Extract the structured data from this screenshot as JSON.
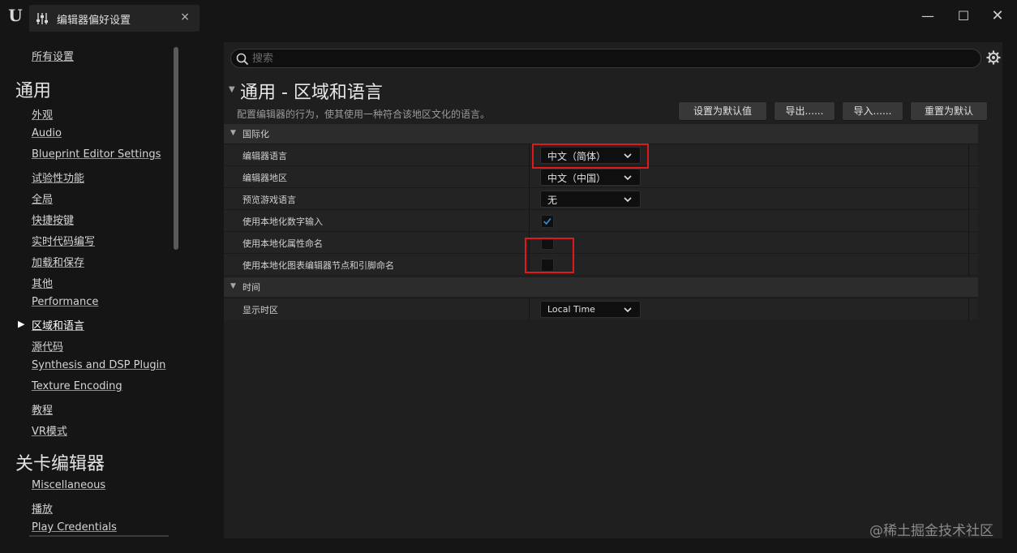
{
  "window": {
    "tab_title": "编辑器偏好设置",
    "tab_close_glyph": "×",
    "minimize_glyph": "—",
    "maximize_glyph": "☐",
    "close_glyph": "✕",
    "logo_text": "U"
  },
  "sidebar": {
    "all_settings": "所有设置",
    "sections": [
      {
        "heading": "通用",
        "items": [
          {
            "label": "外观"
          },
          {
            "label": "Audio"
          },
          {
            "label": "Blueprint Editor Settings"
          },
          {
            "label": "试验性功能"
          },
          {
            "label": "全局"
          },
          {
            "label": "快捷按键"
          },
          {
            "label": "实时代码编写"
          },
          {
            "label": "加载和保存"
          },
          {
            "label": "其他"
          },
          {
            "label": "Performance"
          },
          {
            "label": "区域和语言",
            "selected": true
          },
          {
            "label": "源代码"
          },
          {
            "label": "Synthesis and DSP Plugin"
          },
          {
            "label": "Texture Encoding"
          },
          {
            "label": "教程"
          },
          {
            "label": "VR模式"
          }
        ]
      },
      {
        "heading": "关卡编辑器",
        "items": [
          {
            "label": "Miscellaneous"
          },
          {
            "label": "播放"
          },
          {
            "label": "Play Credentials"
          }
        ]
      }
    ],
    "selected_arrow": "▶"
  },
  "search": {
    "placeholder": "搜索",
    "value": ""
  },
  "page": {
    "title": "通用 - 区域和语言",
    "description": "配置编辑器的行为，使其使用一种符合该地区文化的语言。",
    "collapse_arrow": "▼"
  },
  "toolbar": {
    "set_default_label": "设置为默认值",
    "export_label": "导出......",
    "import_label": "导入......",
    "reset_label": "重置为默认"
  },
  "categories": [
    {
      "label": "国际化",
      "rows": [
        {
          "label": "编辑器语言",
          "type": "dropdown",
          "value": "中文（简体）"
        },
        {
          "label": "编辑器地区",
          "type": "dropdown",
          "value": "中文（中国）"
        },
        {
          "label": "预览游戏语言",
          "type": "dropdown",
          "value": "无"
        },
        {
          "label": "使用本地化数字输入",
          "type": "checkbox",
          "checked": true
        },
        {
          "label": "使用本地化属性命名",
          "type": "checkbox",
          "checked": false
        },
        {
          "label": "使用本地化图表编辑器节点和引脚命名",
          "type": "checkbox",
          "checked": false
        }
      ]
    },
    {
      "label": "时间",
      "rows": [
        {
          "label": "显示时区",
          "type": "dropdown",
          "value": "Local Time"
        }
      ]
    }
  ],
  "colors": {
    "highlight_box": "#e01a1a",
    "check_accent": "#2a8ad8",
    "background": "#151515",
    "panel": "#1f1f1f"
  },
  "watermark": "@稀土掘金技术社区"
}
